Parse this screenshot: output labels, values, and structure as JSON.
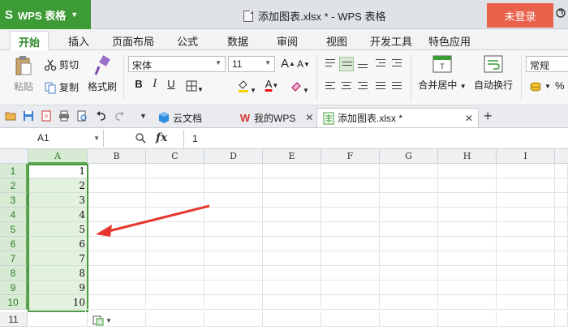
{
  "titlebar": {
    "app_logo": "S",
    "app_name": "WPS 表格",
    "document_title": "添加图表.xlsx * - WPS 表格",
    "login_label": "未登录"
  },
  "ribbon_tabs": [
    "开始",
    "插入",
    "页面布局",
    "公式",
    "数据",
    "审阅",
    "视图",
    "开发工具",
    "特色应用"
  ],
  "ribbon": {
    "paste_label": "粘贴",
    "cut_label": "剪切",
    "copy_label": "复制",
    "format_painter_label": "格式刷",
    "font_name": "宋体",
    "font_size": "11",
    "bold": "B",
    "italic": "I",
    "underline": "U",
    "merge_center_label": "合并居中",
    "wrap_text_label": "自动换行",
    "number_format": "常规",
    "percent_symbol": "%",
    "grow_font": "A",
    "shrink_font": "A"
  },
  "doc_tabs": [
    {
      "label": "云文档"
    },
    {
      "label": "我的WPS"
    },
    {
      "label": "添加图表.xlsx *"
    }
  ],
  "formula_bar": {
    "name_box": "A1",
    "fx_label": "fx",
    "value": "1"
  },
  "grid": {
    "columns": [
      "A",
      "B",
      "C",
      "D",
      "E",
      "F",
      "G",
      "H",
      "I"
    ],
    "rows": [
      "1",
      "2",
      "3",
      "4",
      "5",
      "6",
      "7",
      "8",
      "9",
      "10",
      "11"
    ],
    "column_a_values": [
      "1",
      "2",
      "3",
      "4",
      "5",
      "6",
      "7",
      "8",
      "9",
      "10"
    ]
  },
  "colors": {
    "app_green": "#3d9b35",
    "login_red": "#e9614a",
    "selection_green": "#4e9a45",
    "selection_fill": "#e3f1df",
    "arrow_red": "#e5352c"
  }
}
